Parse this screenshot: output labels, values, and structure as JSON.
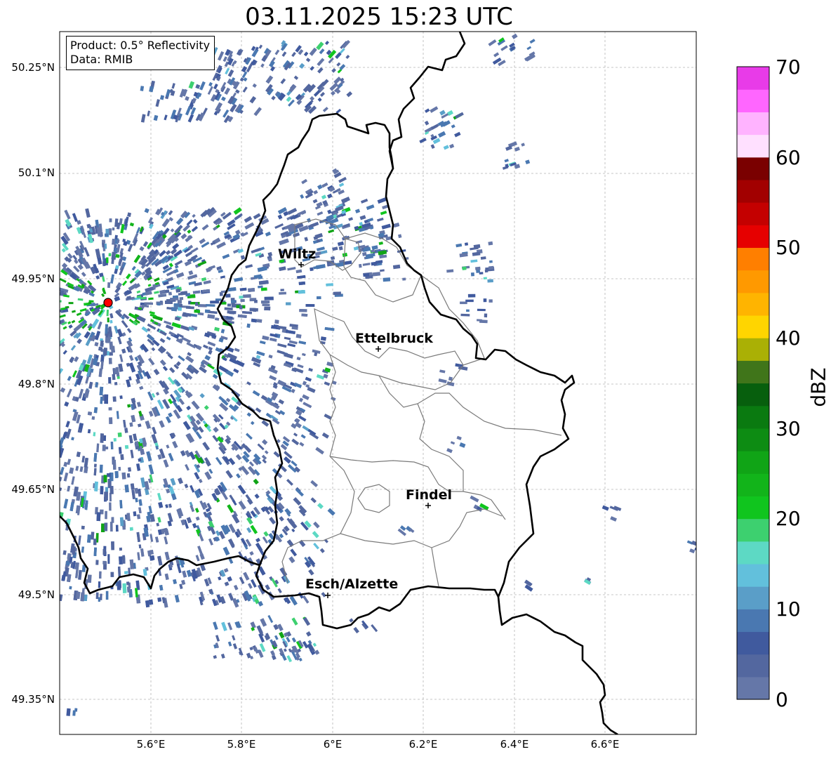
{
  "title": "03.11.2025 15:23 UTC",
  "info": {
    "product": "Product: 0.5° Reflectivity",
    "data": "Data: RMIB"
  },
  "axes": {
    "lat_labels": [
      "50.25°N",
      "50.1°N",
      "49.95°N",
      "49.8°N",
      "49.65°N",
      "49.5°N",
      "49.35°N"
    ],
    "lon_labels": [
      "5.6°E",
      "5.8°E",
      "6°E",
      "6.2°E",
      "6.4°E",
      "6.6°E"
    ]
  },
  "cities": [
    {
      "name": "Wiltz"
    },
    {
      "name": "Ettelbruck"
    },
    {
      "name": "Findel"
    },
    {
      "name": "Esch/Alzette"
    }
  ],
  "colorbar": {
    "label": "dBZ",
    "ticks": [
      "70",
      "60",
      "50",
      "40",
      "30",
      "20",
      "10",
      "0"
    ],
    "colors": [
      "#6577a8",
      "#53679f",
      "#405a9e",
      "#4a78b1",
      "#5a9ec8",
      "#62c0dc",
      "#5dd9c4",
      "#3dd06f",
      "#10c51e",
      "#12b41a",
      "#10a416",
      "#0d8c13",
      "#0a7a10",
      "#075f0d",
      "#40751a",
      "#aab005",
      "#ffd500",
      "#ffb400",
      "#ff9900",
      "#ff7f00",
      "#e60000",
      "#c40000",
      "#a20000",
      "#7a0000",
      "#ffe0ff",
      "#ffb3ff",
      "#ff66ff",
      "#e83be8"
    ]
  },
  "radar_site": {
    "color": "#ff0000"
  }
}
